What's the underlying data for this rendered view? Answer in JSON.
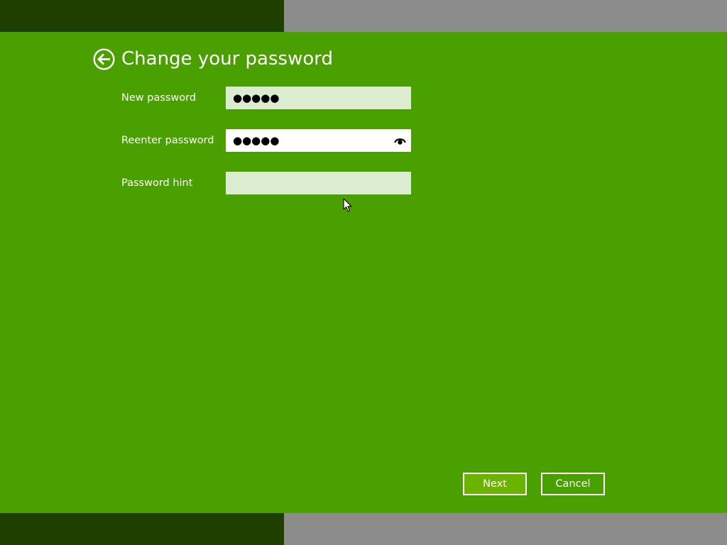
{
  "window": {
    "title": "Change your password"
  },
  "form": {
    "new_password": {
      "label": "New password",
      "value_masked": "●●●●●"
    },
    "reenter_password": {
      "label": "Reenter password",
      "value_masked": "●●●●●",
      "reveal_icon": "eye-icon"
    },
    "password_hint": {
      "label": "Password hint",
      "value": ""
    }
  },
  "buttons": {
    "next_label": "Next",
    "cancel_label": "Cancel"
  },
  "icons": {
    "back": "back-arrow-circle-icon",
    "cursor": "mouse-pointer-icon"
  },
  "colors": {
    "background": "#4aa000",
    "band_dark": "#1f3f00",
    "band_gray": "#8c8c8c",
    "input_unfocused": "#dcecd0",
    "input_focused": "#ffffff",
    "text": "#ffffff"
  }
}
